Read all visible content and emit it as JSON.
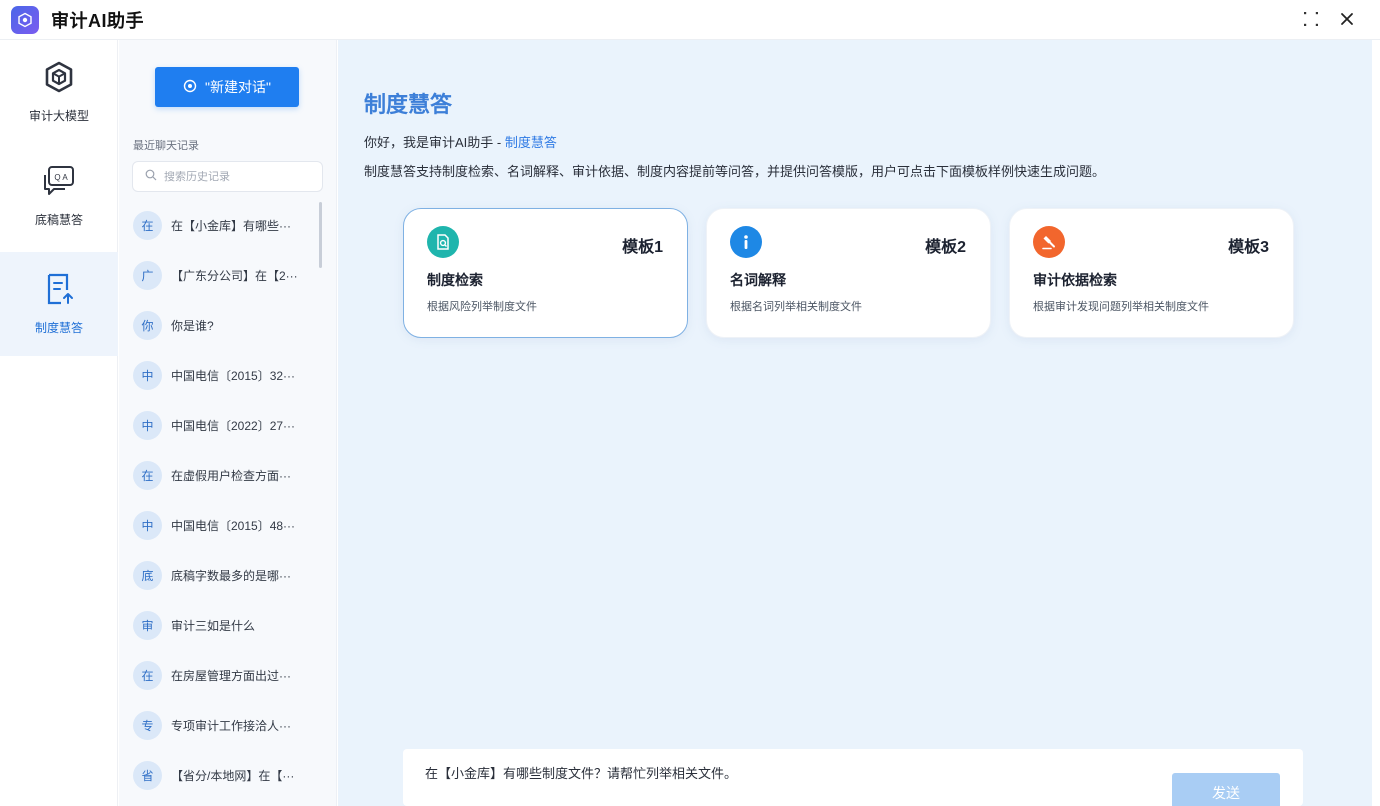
{
  "app": {
    "title": "审计AI助手"
  },
  "window_controls": [
    {
      "name": "fullscreen-icon"
    },
    {
      "name": "close-icon"
    }
  ],
  "nav": {
    "items": [
      {
        "label": "审计大模型",
        "icon": "cube-icon",
        "active": false
      },
      {
        "label": "底稿慧答",
        "icon": "chat-qa-icon",
        "active": false
      },
      {
        "label": "制度慧答",
        "icon": "document-upload-icon",
        "active": true
      }
    ]
  },
  "history": {
    "new_chat_label": "\"新建对话\"",
    "recent_label": "最近聊天记录",
    "search_placeholder": "搜索历史记录",
    "items": [
      {
        "avatar": "在",
        "text": "在【小金库】有哪些···"
      },
      {
        "avatar": "广",
        "text": "【广东分公司】在【2···"
      },
      {
        "avatar": "你",
        "text": "你是谁?"
      },
      {
        "avatar": "中",
        "text": "中国电信〔2015〕32···"
      },
      {
        "avatar": "中",
        "text": "中国电信〔2022〕27···"
      },
      {
        "avatar": "在",
        "text": "在虚假用户检查方面···"
      },
      {
        "avatar": "中",
        "text": "中国电信〔2015〕48···"
      },
      {
        "avatar": "底",
        "text": "底稿字数最多的是哪···"
      },
      {
        "avatar": "审",
        "text": "审计三如是什么"
      },
      {
        "avatar": "在",
        "text": "在房屋管理方面出过···"
      },
      {
        "avatar": "专",
        "text": "专项审计工作接洽人···"
      },
      {
        "avatar": "省",
        "text": "【省分/本地网】在【···"
      }
    ]
  },
  "main": {
    "title": "制度慧答",
    "greeting_prefix": "你好，我是审计AI助手 - ",
    "greeting_mode": "制度慧答",
    "description": "制度慧答支持制度检索、名词解释、审计依据、制度内容提前等问答，并提供问答模版，用户可点击下面模板样例快速生成问题。",
    "cards": [
      {
        "template": "模板1",
        "name": "制度检索",
        "desc": "根据风险列举制度文件",
        "icon": "document-search-icon",
        "icon_color": "#1fb5ad",
        "selected": true
      },
      {
        "template": "模板2",
        "name": "名词解释",
        "desc": "根据名词列举相关制度文件",
        "icon": "info-icon",
        "icon_color": "#1e88e5",
        "selected": false
      },
      {
        "template": "模板3",
        "name": "审计依据检索",
        "desc": "根据审计发现问题列举相关制度文件",
        "icon": "gavel-icon",
        "icon_color": "#f2662d",
        "selected": false
      }
    ],
    "input_value": "在【小金库】有哪些制度文件？请帮忙列举相关文件。",
    "send_label": "发送"
  },
  "colors": {
    "accent": "#1f7ef0",
    "title_blue": "#3d7fd8",
    "main_bg": "#eaf3fc",
    "send_disabled": "#a9cdf4"
  }
}
